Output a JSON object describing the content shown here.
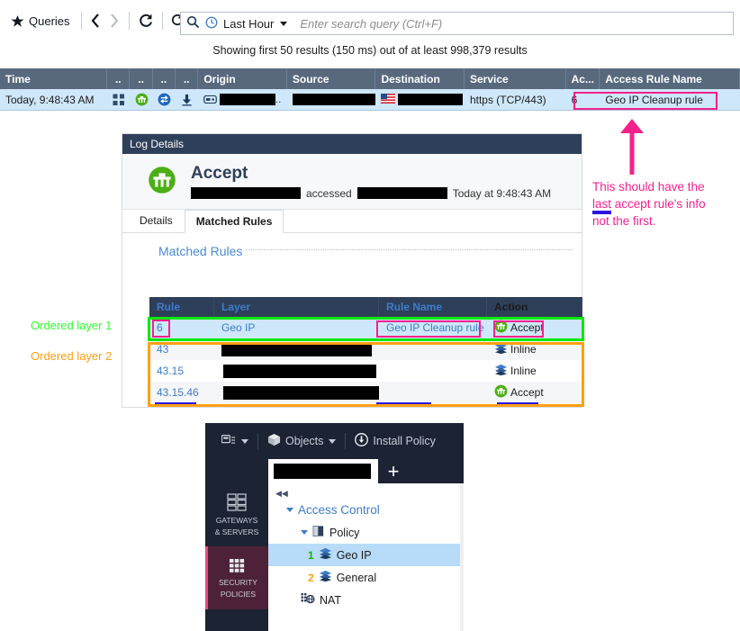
{
  "toolbar": {
    "queries_label": "Queries",
    "back_icon": "chevron-left-icon",
    "forward_icon": "chevron-right-icon",
    "refresh_icon": "refresh-icon",
    "auto_refresh_icon": "auto-refresh-icon"
  },
  "search": {
    "time_range": "Last Hour",
    "placeholder": "Enter search query (Ctrl+F)",
    "value": ""
  },
  "results_line": "Showing first 50 results (150 ms) out of at least 998,379 results",
  "log_table": {
    "columns": [
      "Time",
      "..",
      "..",
      "..",
      "..",
      "Origin",
      "Source",
      "Destination",
      "Service",
      "Ac...",
      "Access Rule Name"
    ],
    "row": {
      "time": "Today, 9:48:43 AM",
      "origin": "",
      "source": "",
      "destination": "",
      "service": "https (TCP/443)",
      "action_num": "6",
      "access_rule_name": "Geo IP Cleanup rule",
      "icons": [
        "apps-grid-icon",
        "accept-gateway-icon",
        "nat-icon",
        "download-icon",
        "blade-icon"
      ],
      "destination_flag": "us-flag-icon"
    }
  },
  "log_details": {
    "title": "Log Details",
    "hero": {
      "action": "Accept",
      "icon": "accept-gateway-icon",
      "accessed_word": "accessed",
      "timestamp": "Today at  9:48:43 AM"
    },
    "tabs": [
      {
        "label": "Details",
        "active": false
      },
      {
        "label": "Matched Rules",
        "active": true
      }
    ],
    "section_label": "Matched Rules"
  },
  "matched_rules": {
    "columns": [
      "Rule",
      "Layer",
      "Rule Name",
      "Action"
    ],
    "rows": [
      {
        "rule": "6",
        "layer": "Geo IP",
        "rule_name": "Geo IP Cleanup rule",
        "action": "Accept",
        "action_icon": "accept-gateway-icon",
        "selected": true
      },
      {
        "rule": "43",
        "layer": "",
        "rule_name": "",
        "action": "Inline",
        "action_icon": "layers-icon",
        "selected": false
      },
      {
        "rule": "43.15",
        "layer": "",
        "rule_name": "",
        "action": "Inline",
        "action_icon": "layers-icon",
        "selected": false
      },
      {
        "rule": "43.15.46",
        "layer": "",
        "rule_name": "",
        "action": "Accept",
        "action_icon": "accept-gateway-icon",
        "selected": false
      }
    ]
  },
  "annotations": {
    "layer1": "Ordered layer 1",
    "layer2": "Ordered layer 2",
    "note_line1": "This should have the",
    "note_underlined": "last",
    "note_line2_rest": " accept rule's info",
    "note_line3": "not the first.",
    "colors": {
      "green": "#00e800",
      "orange": "#ffa013",
      "magenta": "#f4218c",
      "blue_underline": "#2b17e0"
    }
  },
  "smartconsole": {
    "toolbar": {
      "session_icon": "session-icon",
      "objects_label": "Objects",
      "objects_icon": "cube-icon",
      "install_policy_label": "Install Policy",
      "install_policy_icon": "install-policy-icon"
    },
    "tab_label": "",
    "add_tab": "+",
    "collapse_icon": "collapse-left-icon",
    "nav": [
      {
        "label_line1": "GATEWAYS",
        "label_line2": "& SERVERS",
        "icon": "servers-icon",
        "active": false
      },
      {
        "label_line1": "SECURITY",
        "label_line2": "POLICIES",
        "icon": "firewall-icon",
        "active": true
      }
    ],
    "tree": {
      "root": "Access Control",
      "policy": "Policy",
      "items": [
        {
          "num": "1",
          "label": "Geo IP",
          "selected": true,
          "icon": "layers-icon"
        },
        {
          "num": "2",
          "label": "General",
          "selected": false,
          "icon": "layers-icon"
        }
      ],
      "nat": "NAT",
      "nat_icon": "nat-icon"
    }
  }
}
